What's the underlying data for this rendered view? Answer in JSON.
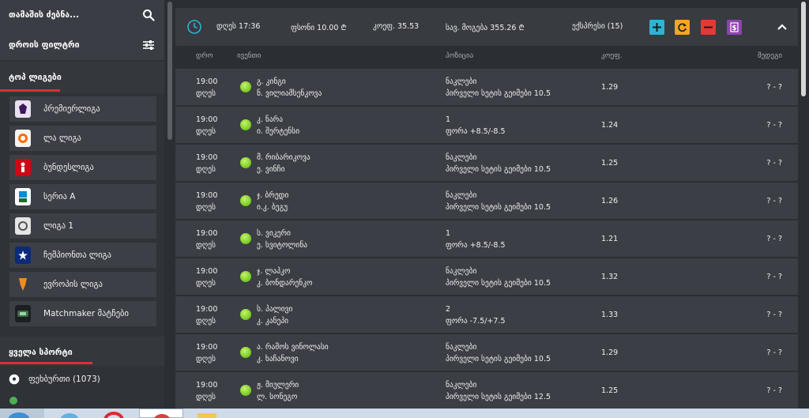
{
  "sidebar": {
    "search_label": "თამაშის ძებნა...",
    "time_filter_label": "დროის ფილტრი",
    "top_leagues_title": "ტოპ ლიგები",
    "leagues": [
      {
        "label": "პრემიერლიგა",
        "icon": "premier-league-logo"
      },
      {
        "label": "ლა ლიგა",
        "icon": "la-liga-logo"
      },
      {
        "label": "ბუნდესლიგა",
        "icon": "bundesliga-logo"
      },
      {
        "label": "სერია A",
        "icon": "serie-a-logo"
      },
      {
        "label": "ლიგა 1",
        "icon": "ligue-1-logo"
      },
      {
        "label": "ჩემპიონთა ლიგა",
        "icon": "champions-league-logo"
      },
      {
        "label": "ევროპის ლიგა",
        "icon": "europa-league-logo"
      },
      {
        "label": "Matchmaker მატჩები",
        "icon": "matchmaker-logo"
      }
    ],
    "all_sports_title": "ყველა სპორტი",
    "sports": [
      {
        "label": "ფეხბურთი (1073)",
        "icon": "football-icon"
      }
    ]
  },
  "coupon": {
    "date": "დღეს 17:36",
    "stake": "ფსონი  10.00  ₾",
    "odds": "კოეფ.  35.53",
    "potential_win": "სავ. მოგება  355.26  ₾",
    "express": "ექსპრესი (15)",
    "colors": {
      "add": "#29b6d6",
      "refresh": "#f5a623",
      "remove": "#e53935",
      "cashout": "#8e44ad"
    }
  },
  "columns": {
    "time": "დრო",
    "event": "ივენთი",
    "position": "პოზიცია",
    "odds": "კოეფ.",
    "result": "შედეგი"
  },
  "bets": [
    {
      "time": "19:00",
      "day": "დღეს",
      "player1": "გ. კინგი",
      "player2": "ნ. ვილიამსენკოვა",
      "pick": "ნაკლები",
      "market": "პირველი სეტის გეიმები 10.5",
      "odd": "1.29",
      "result": "? - ?"
    },
    {
      "time": "19:00",
      "day": "დღეს",
      "player1": "კ. ნარა",
      "player2": "ი. შერტენსი",
      "pick": "1",
      "market": "ფორა +8.5/-8.5",
      "odd": "1.24",
      "result": "? - ?"
    },
    {
      "time": "19:00",
      "day": "დღეს",
      "player1": "მ. რიბარიკოვა",
      "player2": "ე. ვინჩი",
      "pick": "ნაკლები",
      "market": "პირველი სეტის გეიმები 10.5",
      "odd": "1.25",
      "result": "? - ?"
    },
    {
      "time": "19:00",
      "day": "დღეს",
      "player1": "ჯ. ბრედი",
      "player2": "ი.კ. ბეგუ",
      "pick": "ნაკლები",
      "market": "პირველი სეტის გეიმები 10.5",
      "odd": "1.26",
      "result": "? - ?"
    },
    {
      "time": "19:00",
      "day": "დღეს",
      "player1": "ს. ვიკერი",
      "player2": "ე. სვიტოლინა",
      "pick": "1",
      "market": "ფორა +8.5/-8.5",
      "odd": "1.21",
      "result": "? - ?"
    },
    {
      "time": "19:00",
      "day": "დღეს",
      "player1": "ჯ. ლაპკო",
      "player2": "კ. ბონდარენკო",
      "pick": "ნაკლები",
      "market": "პირველი სეტის გეიმები 10.5",
      "odd": "1.32",
      "result": "? - ?"
    },
    {
      "time": "19:00",
      "day": "დღეს",
      "player1": "ს. პალივი",
      "player2": "კ. კანეპი",
      "pick": "2",
      "market": "ფორა -7.5/+7.5",
      "odd": "1.33",
      "result": "? - ?"
    },
    {
      "time": "19:00",
      "day": "დღეს",
      "player1": "ა. რამოს ვინოლასი",
      "player2": "კ. ხაჩანოვი",
      "pick": "ნაკლები",
      "market": "პირველი სეტის გეიმები 10.5",
      "odd": "1.29",
      "result": "? - ?"
    },
    {
      "time": "19:00",
      "day": "დღეს",
      "player1": "ჟ. მიულერი",
      "player2": "ლ. სონეგო",
      "pick": "ნაკლები",
      "market": "პირველი სეტის გეიმები 12.5",
      "odd": "1.25",
      "result": "? - ?"
    }
  ]
}
